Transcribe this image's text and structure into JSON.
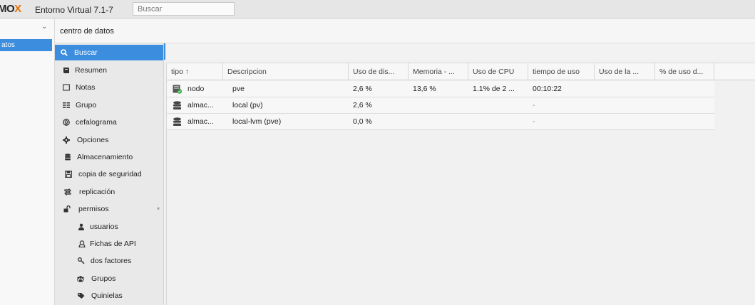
{
  "topbar": {
    "logo_main": "MO",
    "logo_x": "X",
    "app_title": "Entorno Virtual 7.1-7",
    "search_placeholder": "Buscar"
  },
  "tree": {
    "toggle_symbol": "⌄",
    "selected_label": "atos"
  },
  "breadcrumb": "centro de datos",
  "menu": {
    "items": [
      {
        "label": "Buscar",
        "icon": "search-icon",
        "active": true
      },
      {
        "label": "Resumen",
        "icon": "book-icon"
      },
      {
        "label": "Notas",
        "icon": "note-icon"
      },
      {
        "label": "Grupo",
        "icon": "cluster-icon"
      },
      {
        "label": "cefalograma",
        "icon": "ceph-icon"
      },
      {
        "label": "Opciones",
        "icon": "gear-icon"
      },
      {
        "label": "Almacenamiento",
        "icon": "database-icon"
      },
      {
        "label": "copia de seguridad",
        "icon": "floppy-icon"
      },
      {
        "label": "replicación",
        "icon": "retweet-icon"
      },
      {
        "label": "permisos",
        "icon": "unlock-icon",
        "expandable": true
      },
      {
        "label": "usuarios",
        "icon": "user-icon",
        "sub": true
      },
      {
        "label": "Fichas de API",
        "icon": "key-icon",
        "sub": true
      },
      {
        "label": "dos factores",
        "icon": "two-factor-key-icon",
        "sub": true
      },
      {
        "label": "Grupos",
        "icon": "users-icon",
        "sub": true
      },
      {
        "label": "Quinielas",
        "icon": "tags-icon",
        "sub": true
      }
    ]
  },
  "grid": {
    "columns": [
      "tipo ↑",
      "Descripcion",
      "Uso de dis...",
      "Memoria - ...",
      "Uso de CPU",
      "tiempo de uso",
      "Uso de la ...",
      "% de uso d..."
    ],
    "rows": [
      {
        "icon": "node-icon",
        "tipo": "nodo",
        "descripcion": "pve",
        "disco": "2,6 %",
        "memoria": "13,6 %",
        "cpu": "1.1% de 2 ...",
        "tiempo": "00:10:22"
      },
      {
        "icon": "storage-icon",
        "tipo": "almac...",
        "descripcion": "local (pv)",
        "disco": "2,6 %",
        "memoria": "",
        "cpu": "",
        "tiempo": "-"
      },
      {
        "icon": "storage-icon",
        "tipo": "almac...",
        "descripcion": "local-lvm (pve)",
        "disco": "0,0 %",
        "memoria": "",
        "cpu": "",
        "tiempo": "-"
      }
    ]
  },
  "colors": {
    "accent": "#3c8dde",
    "logo_orange": "#e57000",
    "node_green": "#2a9d3a"
  }
}
